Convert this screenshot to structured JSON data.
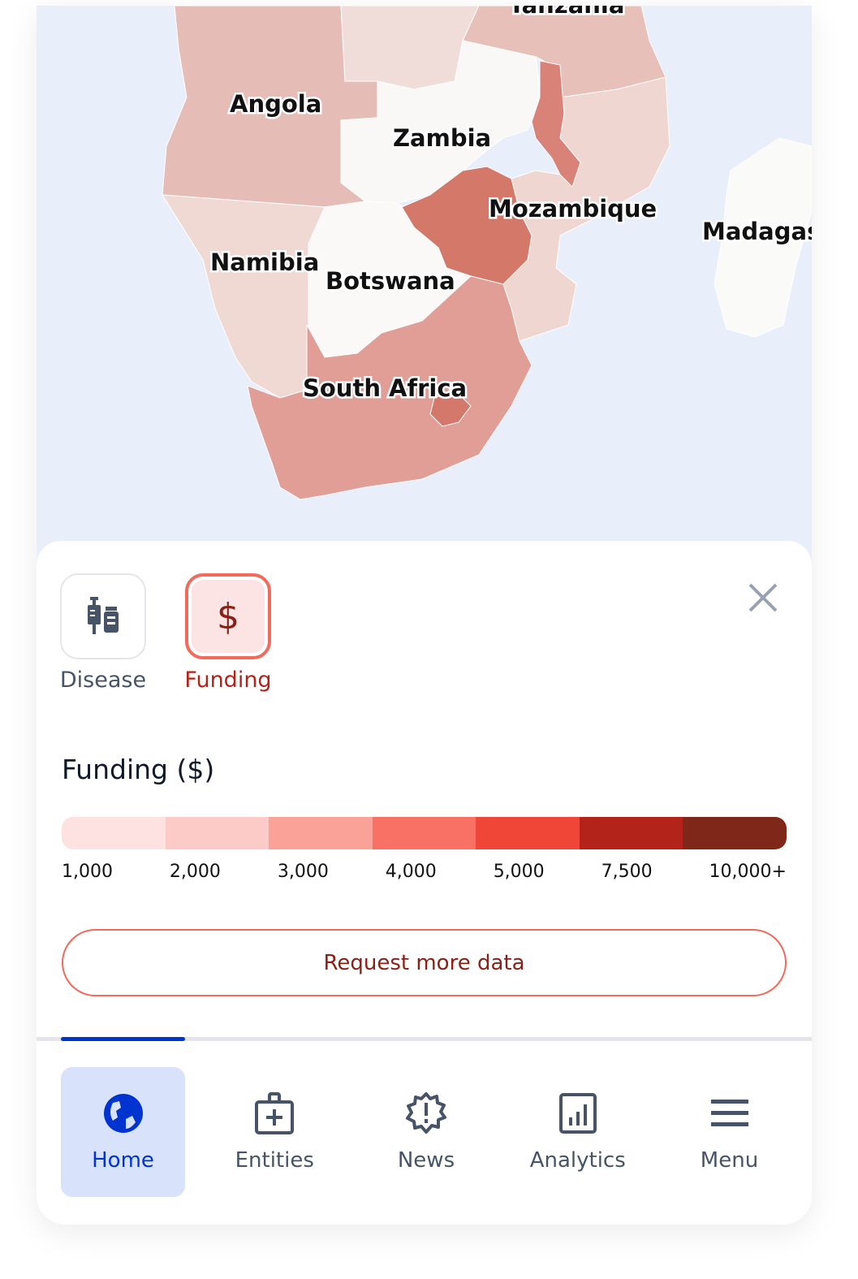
{
  "map": {
    "labels": {
      "tanzania": "Tanzania",
      "angola": "Angola",
      "zambia": "Zambia",
      "mozambique": "Mozambique",
      "madagascar": "Madagascar",
      "namibia": "Namibia",
      "botswana": "Botswana",
      "south_africa": "South Africa"
    },
    "ocean_color": "#e9eefb"
  },
  "layers": [
    {
      "label": "Disease",
      "icon": "syringe-vial-icon",
      "active": false
    },
    {
      "label": "Funding",
      "icon": "dollar-icon",
      "active": true
    }
  ],
  "legend": {
    "title": "Funding ($)",
    "colors": [
      "#fde2e1",
      "#fdcbc7",
      "#faa298",
      "#f87164",
      "#f04637",
      "#b32319",
      "#7f2719"
    ],
    "ticks": [
      "1,000",
      "2,000",
      "3,000",
      "4,000",
      "5,000",
      "7,500",
      "10,000+"
    ]
  },
  "request_button": "Request more data",
  "nav": [
    {
      "label": "Home",
      "icon": "globe-icon",
      "active": true
    },
    {
      "label": "Entities",
      "icon": "medical-bag-icon",
      "active": false
    },
    {
      "label": "News",
      "icon": "alert-badge-icon",
      "active": false
    },
    {
      "label": "Analytics",
      "icon": "bar-chart-icon",
      "active": false
    },
    {
      "label": "Menu",
      "icon": "hamburger-menu-icon",
      "active": false
    }
  ],
  "accent": "#0034d1"
}
